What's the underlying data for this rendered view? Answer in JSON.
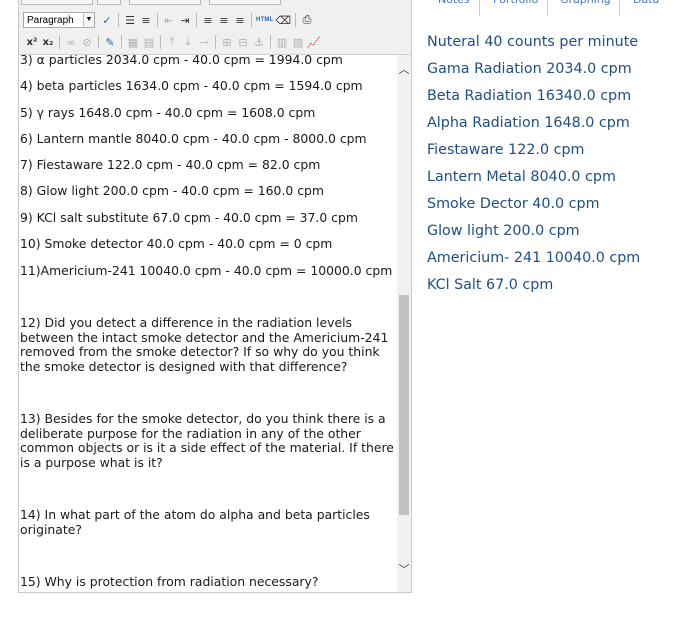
{
  "editor": {
    "format_select": "Paragraph",
    "toolbar_row1": {
      "html_label": "HTML"
    },
    "toolbar_row2": {
      "superscript": "x²",
      "subscript": "x₂"
    },
    "lines": [
      "3) α particles 2034.0 cpm - 40.0 cpm = 1994.0 cpm",
      "4)  beta particles 1634.0 cpm - 40.0 cpm = 1594.0 cpm",
      "5) γ  rays 1648.0 cpm - 40.0 cpm = 1608.0 cpm",
      "6) Lantern mantle 8040.0 cpm - 40.0 cpm - 8000.0 cpm",
      "7) Fiestaware 122.0 cpm - 40.0 cpm = 82.0 cpm",
      "8) Glow light 200.0 cpm - 40.0 cpm = 160.0 cpm",
      "9) KCl salt substitute 67.0 cpm - 40.0 cpm = 37.0 cpm",
      "10) Smoke detector 40.0 cpm - 40.0 cpm = 0 cpm",
      "11)Americium-241 10040.0 cpm - 40.0 cpm = 10000.0 cpm"
    ],
    "questions": [
      "12) Did you detect a difference in the radiation levels between the intact smoke detector and the Americium-241 removed from the smoke detector? If so why do you think the smoke detector is designed with that difference?",
      "13) Besides for the smoke detector, do you think there is a deliberate purpose for the radiation in any of the other common objects or is it a side effect of the material. If there is a purpose what is it?",
      "14) In what part of the atom do alpha and beta particles originate?",
      "15) Why is protection from radiation necessary?"
    ]
  },
  "tabs": [
    "Notes",
    "Portfolio",
    "Graphing",
    "Data"
  ],
  "notes": [
    "Nuteral 40 counts per minute",
    "Gama Radiation 2034.0 cpm",
    "Beta Radiation 16340.0 cpm",
    "Alpha Radiation 1648.0 cpm",
    "Fiestaware 122.0 cpm",
    "Lantern Metal 8040.0 cpm",
    "Smoke Dector 40.0 cpm",
    "Glow light 200.0 cpm",
    "Americium- 241 10040.0 cpm",
    "KCl Salt 67.0 cpm"
  ],
  "colors": {
    "note_text": "#1f4d86",
    "tab_text": "#4a72c4",
    "toolbar_bg": "#f0f0f0"
  }
}
